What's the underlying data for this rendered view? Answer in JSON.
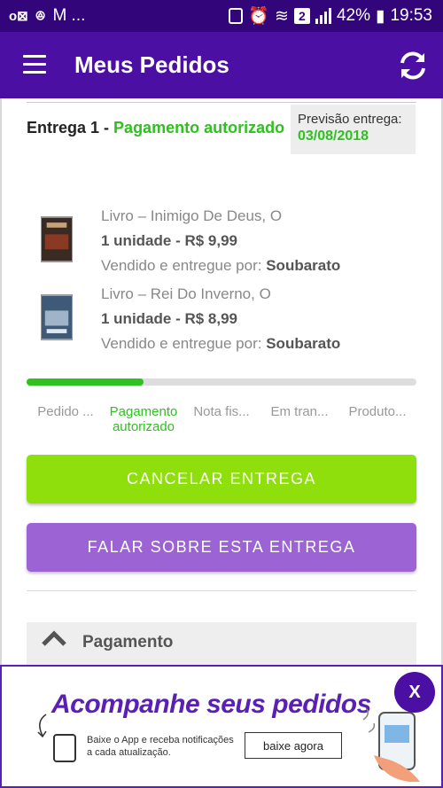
{
  "status_bar": {
    "left_text": "M ...",
    "battery": "42%",
    "time": "19:53",
    "network_badge": "2"
  },
  "app_bar": {
    "title": "Meus Pedidos",
    "menu_icon": "hamburger-icon",
    "refresh_icon": "refresh-icon"
  },
  "delivery": {
    "title_prefix": "Entrega 1 -",
    "status": "Pagamento autorizado",
    "forecast_label": "Previsão entrega:",
    "forecast_date": "03/08/2018"
  },
  "items": [
    {
      "name": "Livro – Inimigo De Deus, O",
      "quantity": "1 unidade - R$ 9,99",
      "seller_label": "Vendido e entregue por:",
      "seller": "Soubarato"
    },
    {
      "name": "Livro – Rei Do Inverno, O",
      "quantity": "1 unidade - R$ 8,99",
      "seller_label": "Vendido e entregue por:",
      "seller": "Soubarato"
    }
  ],
  "progress": {
    "fraction": 0.3,
    "steps": [
      "Pedido ...",
      "Pagamento autorizado",
      "Nota fis...",
      "Em tran...",
      "Produto..."
    ]
  },
  "buttons": {
    "cancel": "CANCELAR ENTREGA",
    "talk": "FALAR SOBRE ESTA ENTREGA"
  },
  "payment_section": {
    "title": "Pagamento"
  },
  "banner": {
    "headline": "Acompanhe seus pedidos",
    "text": "Baixe o App e receba notificações a cada atualização.",
    "button": "baixe agora",
    "close": "X"
  },
  "colors": {
    "primary": "#4b0fa3",
    "green": "#2ec11f",
    "cancel_button": "#8edf0b",
    "talk_button": "#9b63d4"
  }
}
